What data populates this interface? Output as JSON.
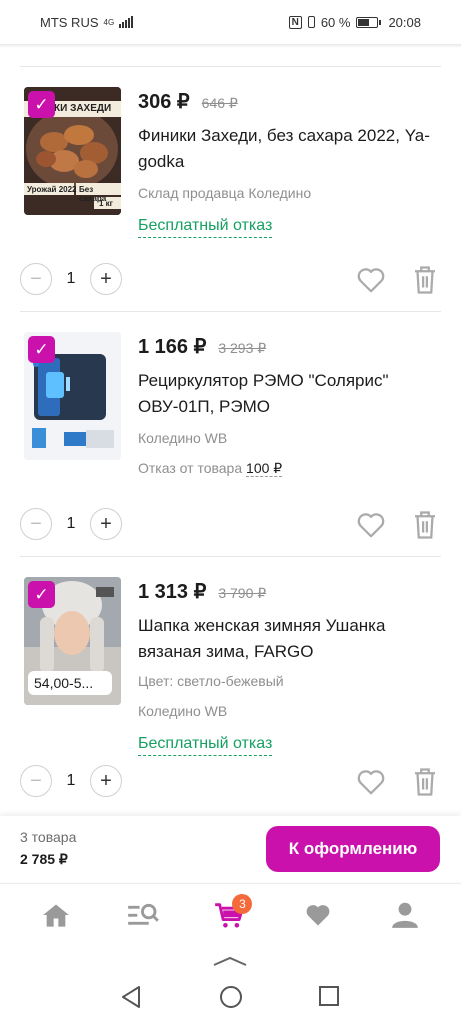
{
  "status_bar": {
    "carrier": "MTS RUS",
    "network": "4G",
    "nfc": "N",
    "battery": "60 %",
    "time": "20:08"
  },
  "items": [
    {
      "price": "306 ₽",
      "old_price": "646 ₽",
      "title": "Финики Захеди, без сахара 2022, Ya-godka",
      "warehouse": "Склад продавца Коледино",
      "refund": "Бесплатный отказ",
      "qty": "1",
      "thumb_text": [
        "КИ ЗАХЕДИ",
        "Урожай 2022",
        "Без сахара",
        "1 кг"
      ]
    },
    {
      "price": "1 166 ₽",
      "old_price": "3 293 ₽",
      "title": "Рециркулятор РЭМО \"Солярис\" ОВУ-01П, РЭМО",
      "warehouse": "Коледино WB",
      "refund_prefix": "Отказ от товара",
      "refund_amount": "100 ₽",
      "qty": "1"
    },
    {
      "price": "1 313 ₽",
      "old_price": "3 790 ₽",
      "title": "Шапка женская зимняя Ушанка вязаная зима, FARGO",
      "color": "Цвет: светло-бежевый",
      "warehouse": "Коледино WB",
      "refund": "Бесплатный отказ",
      "qty": "1",
      "thumb_size": "54,00-5..."
    }
  ],
  "summary": {
    "count": "3 товара",
    "total": "2 785 ₽",
    "checkout_label": "К оформлению"
  },
  "tabbar": {
    "cart_badge": "3",
    "accent": "#cb11ab"
  },
  "colors": {
    "brand": "#cb11ab",
    "free_refund": "#16a061",
    "badge": "#f46a3b"
  }
}
